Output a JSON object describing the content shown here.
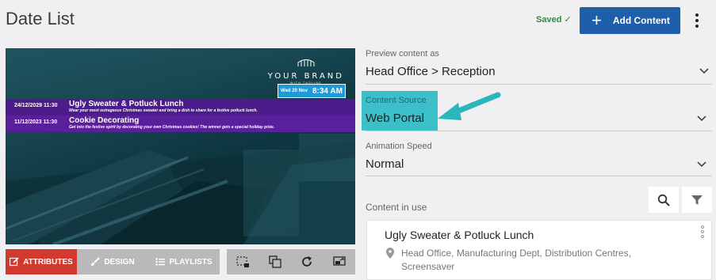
{
  "header": {
    "title": "Date List",
    "saved_text": "Saved",
    "saved_icon": "check-icon",
    "add_button_label": "Add Content",
    "add_icon": "plus-icon",
    "menu_icon": "kebab-menu-icon"
  },
  "preview": {
    "brand_logo": "YOUR BRAND",
    "brand_sub": "WITH TAGLINE",
    "clock_date": "Wed 20 Nov",
    "clock_time": "8:34 AM",
    "events": [
      {
        "date": "24/12/2029 11:30",
        "title": "Ugly Sweater & Potluck Lunch",
        "description": "Wear your most outrageous Christmas sweater and bring a dish to share for a festive potluck lunch."
      },
      {
        "date": "11/12/2023 11:30",
        "title": "Cookie Decorating",
        "description": "Get into the festive spirit by decorating your own Christmas cookies! The winner gets a special holiday prize."
      }
    ]
  },
  "toolbar": {
    "attributes_label": "ATTRIBUTES",
    "design_label": "DESIGN",
    "playlists_label": "PLAYLISTS",
    "colors": {
      "active": "#d23a30",
      "inactive": "#b9b8bb"
    }
  },
  "form": {
    "preview_as": {
      "label": "Preview content as",
      "value": "Head Office > Reception"
    },
    "content_source": {
      "label": "Content Source",
      "value": "Web Portal"
    },
    "animation_speed": {
      "label": "Animation Speed",
      "value": "Normal"
    },
    "content_in_use": {
      "label": "Content in use"
    },
    "highlight_color": "#3bbfc8",
    "accent_color": "#1f5ea8"
  },
  "content_card": {
    "title": "Ugly Sweater & Potluck Lunch",
    "locations": "Head Office, Manufacturing Dept, Distribution Centres, Screensaver"
  }
}
